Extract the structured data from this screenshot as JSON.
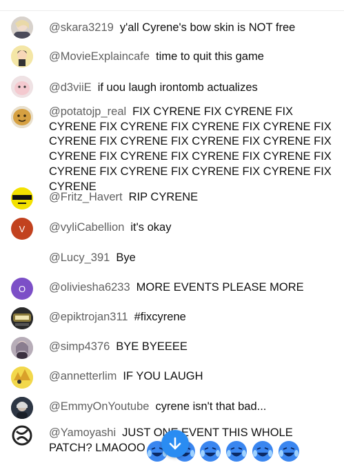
{
  "messages": [
    {
      "author": "@skara3219",
      "text": "y'all Cyrene's bow skin is NOT free",
      "avatar": "photo-avatar"
    },
    {
      "author": "@MovieExplaincafe",
      "text": "time to quit this game",
      "avatar": "cartoon-avatar"
    },
    {
      "author": "@d3viiE",
      "text": "if uou laugh irontomb actualizes",
      "avatar": "pink-avatar"
    },
    {
      "author": "@potatojp_real",
      "text": "FIX CYRENE FIX CYRENE FIX CYRENE FIX CYRENE FIX CYRENE FIX CYRENE FIX CYRENE FIX CYRENE FIX CYRENE FIX CYRENE FIX CYRENE FIX CYRENE FIX CYRENE FIX CYRENE FIX CYRENE FIX CYRENE FIX CYRENE FIX CYRENE FIX CYRENE",
      "avatar": "potato-avatar"
    },
    {
      "author": "@Fritz_Havert",
      "text": "RIP CYRENE",
      "avatar": "sunglasses-face-avatar"
    },
    {
      "author": "@vyliCabellion",
      "text": "it's okay",
      "avatar": "letter-avatar",
      "avatar_letter": "V",
      "avatar_color": "#c2421f"
    },
    {
      "author": "@Lucy_391",
      "text": "Bye",
      "avatar": "blank-avatar"
    },
    {
      "author": "@oliviesha6233",
      "text": "MORE EVENTS PLEASE MORE",
      "avatar": "letter-avatar",
      "avatar_letter": "O",
      "avatar_color": "#7c4fc7"
    },
    {
      "author": "@epiktrojan311",
      "text": "#fixcyrene",
      "avatar": "badge-avatar"
    },
    {
      "author": "@simp4376",
      "text": "BYE BYEEEE",
      "avatar": "photo-avatar"
    },
    {
      "author": "@annetterlim",
      "text": "IF YOU LAUGH",
      "avatar": "yellow-avatar"
    },
    {
      "author": "@EmmyOnYoutube",
      "text": "cyrene isn't that bad...",
      "avatar": "dark-avatar"
    },
    {
      "author": "@Yamoyashi",
      "text": "JUST ONE EVENT THIS WHOLE PATCH? LMAOOO",
      "avatar": "logo-avatar"
    }
  ],
  "scroll_button": {
    "icon": "arrow-down-icon",
    "color": "#2a8cf2"
  },
  "emoji_row": {
    "icon": "crying-laughing-emoji",
    "count": 6,
    "color": "#3a86f0"
  }
}
